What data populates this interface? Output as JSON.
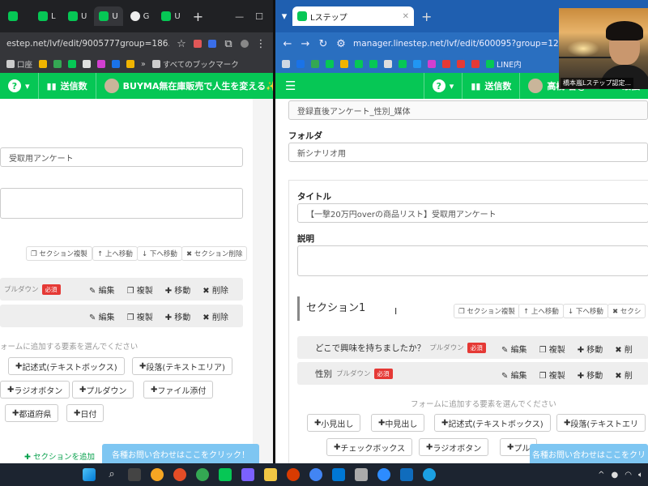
{
  "left_window": {
    "tabs": [
      {
        "label": "",
        "active": false
      },
      {
        "label": "L",
        "active": false
      },
      {
        "label": "U",
        "active": false
      },
      {
        "label": "U",
        "active": false
      },
      {
        "label": "G",
        "active": false
      },
      {
        "label": "U",
        "active": false
      }
    ],
    "url": "estep.net/lvf/edit/9005777group=186...",
    "bookmarks": [
      "口座",
      "»",
      "すべてのブックマーク"
    ],
    "appbar": {
      "send_count_label": "送信数",
      "account_label": "BUYMA無在庫販売で人生を変える✨"
    },
    "title_value": "受取用アンケート",
    "section_tools": [
      "セクション複製",
      "上へ移動",
      "下へ移動",
      "セクション削除"
    ],
    "row1_sub": "プルダウン",
    "required_label": "必須",
    "row_actions": [
      "編集",
      "複製",
      "移動",
      "削除"
    ],
    "add_hint": "ォームに追加する要素を選んでください",
    "add_buttons": [
      "記述式(テキストボックス)",
      "段落(テキストエリア)",
      "ラジオボタン",
      "プルダウン",
      "ファイル添付",
      "都道府県",
      "日付"
    ],
    "add_section_label": "セクションを追加",
    "contact_banner": "各種お問い合わせはここをクリック！"
  },
  "right_window": {
    "tab_label": "Lステップ",
    "url": "manager.linestep.net/lvf/edit/600095?group=126554",
    "bookmarks": [
      "LINE内"
    ],
    "appbar": {
      "send_count_label": "送信数",
      "account_label": "高橋 督@BUYMA最強"
    },
    "top_field_value": "登録直後アンケート_性別_媒体",
    "folder_label": "フォルダ",
    "folder_value": "新シナリオ用",
    "title_label": "タイトル",
    "title_value": "【一撃20万円overの商品リスト】受取用アンケート",
    "description_label": "説明",
    "section_title": "セクション1",
    "section_tools": [
      "セクション複製",
      "上へ移動",
      "下へ移動",
      "セクシ"
    ],
    "rows": [
      {
        "title": "どこで興味を持ちましたか？",
        "sub": "プルダウン",
        "required": "必須"
      },
      {
        "title": "性別",
        "sub": "プルダウン",
        "required": "必須"
      }
    ],
    "row_actions": [
      "編集",
      "複製",
      "移動",
      "削"
    ],
    "add_hint": "フォームに追加する要素を選んでください",
    "add_buttons_row1": [
      "小見出し",
      "中見出し",
      "記述式(テキストボックス)",
      "段落(テキストエリ"
    ],
    "add_buttons_row2": [
      "チェックボックス",
      "ラジオボタン",
      "プル"
    ],
    "contact_banner": "各種お問い合わせはここをクリ"
  },
  "video_overlay": {
    "caption": "橋本嵐Lステップ認定..."
  },
  "colors": {
    "line_green": "#06c755",
    "right_chrome": "#1f5fb0",
    "left_chrome": "#202124",
    "required_red": "#e53935",
    "banner_blue": "#7ec6f2"
  }
}
